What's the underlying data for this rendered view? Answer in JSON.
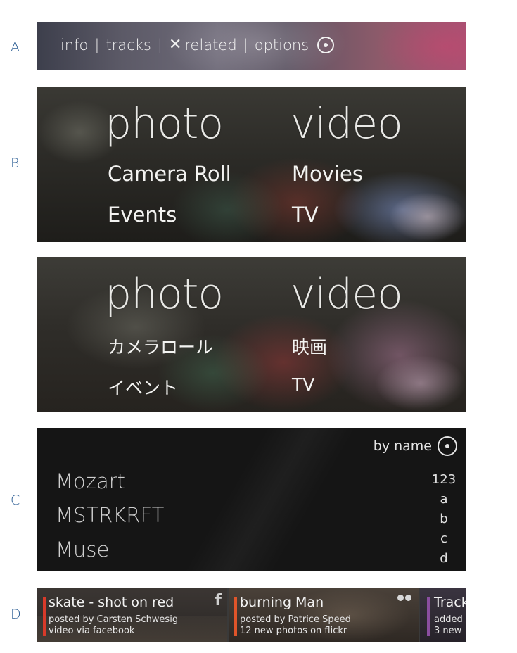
{
  "section_letters": [
    "A",
    "B",
    "C",
    "D"
  ],
  "menu": {
    "info": "info",
    "tracks": "tracks",
    "related": "related",
    "options": "options",
    "separator": "|"
  },
  "hub_en": {
    "photo": "photo",
    "video": "video",
    "camera_roll": "Camera Roll",
    "events": "Events",
    "movies": "Movies",
    "tv": "TV"
  },
  "hub_ja": {
    "photo": "photo",
    "video": "video",
    "camera_roll": "カメラロール",
    "events": "イベント",
    "movies": "映画",
    "tv": "TV"
  },
  "artists": {
    "sort_label": "by name",
    "items": [
      "Mozart",
      "MSTRKRFT",
      "Muse"
    ],
    "jump_index": [
      "123",
      "a",
      "b",
      "c",
      "d"
    ]
  },
  "feed": {
    "cards": [
      {
        "title": "skate - shot on red",
        "line1": "posted by Carsten Schwesig",
        "line2": "video via facebook",
        "accent": "#d83a2a",
        "icon": "facebook-icon"
      },
      {
        "title": "burning Man",
        "line1": "posted by Patrice Speed",
        "line2": "12 new photos on flickr",
        "accent": "#e0552a",
        "icon": "flickr-icon"
      },
      {
        "title": "Track",
        "line1": "added",
        "line2": "3 new",
        "accent": "#8a4ea0",
        "icon": ""
      }
    ]
  }
}
